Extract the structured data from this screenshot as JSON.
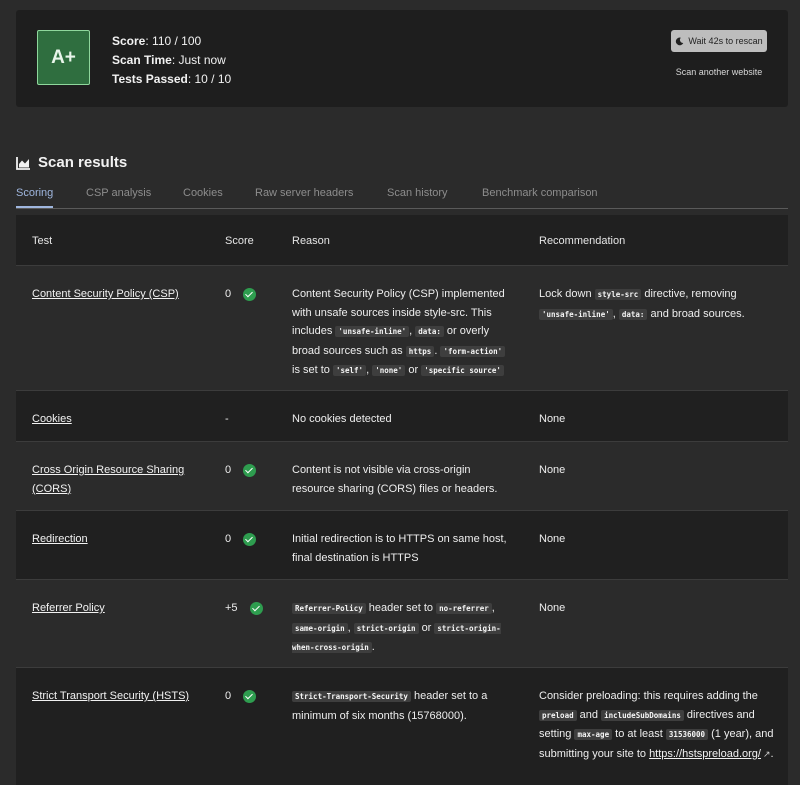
{
  "summary": {
    "grade": "A+",
    "score_label": "Score",
    "score_value": "110 / 100",
    "scan_time_label": "Scan Time",
    "scan_time_value": "Just now",
    "tests_passed_label": "Tests Passed",
    "tests_passed_value": "10 / 10",
    "rescan_label": "Wait 42s to rescan",
    "scan_another_label": "Scan another website",
    "colors": {
      "grade_bg": "#2f6e3f",
      "grade_border": "#8fd79c"
    }
  },
  "section": {
    "title": "Scan results",
    "icon": "area-chart-icon"
  },
  "tabs": [
    {
      "label": "Scoring",
      "active": true
    },
    {
      "label": "CSP analysis",
      "active": false
    },
    {
      "label": "Cookies",
      "active": false
    },
    {
      "label": "Raw server headers",
      "active": false
    },
    {
      "label": "Scan history",
      "active": false
    },
    {
      "label": "Benchmark comparison",
      "active": false
    }
  ],
  "table": {
    "headers": {
      "test": "Test",
      "score": "Score",
      "reason": "Reason",
      "recommendation": "Recommendation"
    },
    "rows": {
      "csp": {
        "test": "Content Security Policy (CSP)",
        "score": "0",
        "passed": true,
        "reason": {
          "t1": "Content Security Policy (CSP) implemented with unsafe sources inside style-src. This includes",
          "c1": "'unsafe-inline'",
          "t2": ",",
          "c2": "data:",
          "t3": "or overly broad sources such as",
          "c3": "https",
          "t4": ".",
          "c4": "'form-action'",
          "t5": "is set to",
          "c5": "'self'",
          "t6": ",",
          "c6": "'none'",
          "t7": "or",
          "c7": "'specific source'"
        },
        "recommendation": {
          "t1": "Lock down",
          "c1": "style-src",
          "t2": "directive, removing",
          "c2": "'unsafe-inline'",
          "t3": ",",
          "c3": "data:",
          "t4": "and broad sources."
        }
      },
      "cookies": {
        "test": "Cookies",
        "score": "-",
        "reason": "No cookies detected",
        "recommendation": "None"
      },
      "cors": {
        "test": "Cross Origin Resource Sharing (CORS)",
        "score": "0",
        "passed": true,
        "reason": "Content is not visible via cross-origin resource sharing (CORS) files or headers.",
        "recommendation": "None"
      },
      "redirection": {
        "test": "Redirection",
        "score": "0",
        "passed": true,
        "reason": "Initial redirection is to HTTPS on same host, final destination is HTTPS",
        "recommendation": "None"
      },
      "referrer": {
        "test": "Referrer Policy",
        "score": "+5",
        "passed": true,
        "reason": {
          "c1": "Referrer-Policy",
          "t1": "header set to",
          "c2": "no-referrer",
          "t2": ",",
          "c3": "same-origin",
          "t3": ",",
          "c4": "strict-origin",
          "t4": "or",
          "c5": "strict-origin-when-cross-origin",
          "t5": "."
        },
        "recommendation": "None"
      },
      "hsts": {
        "test": "Strict Transport Security (HSTS)",
        "score": "0",
        "passed": true,
        "reason": {
          "c1": "Strict-Transport-Security",
          "t1": "header set to a minimum of six months (15768000)."
        },
        "recommendation": {
          "t1": "Consider preloading: this requires adding the",
          "c1": "preload",
          "t2": "and",
          "c2": "includeSubDomains",
          "t3": "directives and setting",
          "c3": "max-age",
          "t4": "to at least",
          "c4": "31536000",
          "t5": "(1 year), and submitting your site to",
          "link": "https://hstspreload.org/",
          "t6": "."
        }
      }
    }
  }
}
